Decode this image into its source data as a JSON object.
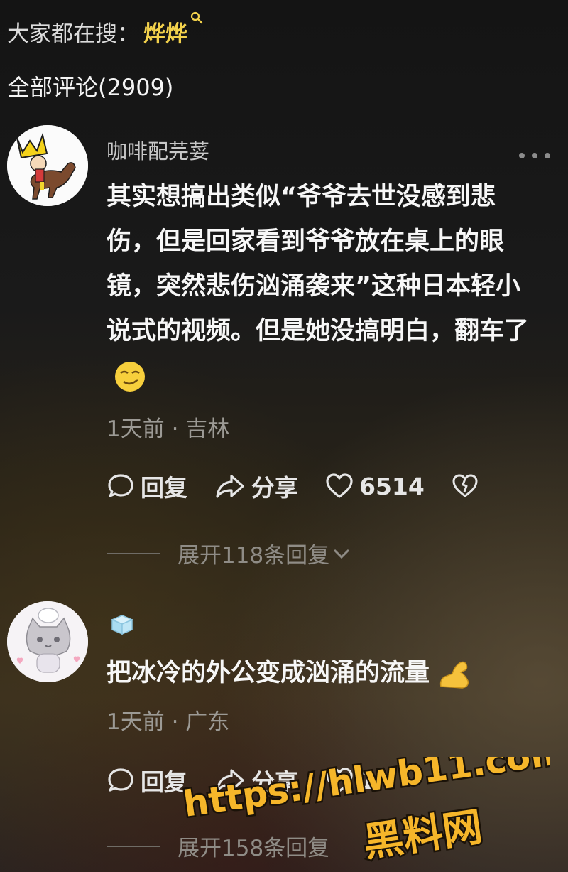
{
  "header": {
    "search_prefix": "大家都在搜：",
    "search_keyword": "烨烨",
    "comment_count_label": "全部评论(2909)"
  },
  "comments": [
    {
      "username": "咖啡配芫荽",
      "text": "其实想搞出类似“爷爷去世没感到悲伤，但是回家看到爷爷放在桌上的眼镜，突然悲伤汹涌袭来”这种日本轻小说式的视频。但是她没搞明白，翻车了",
      "time_location": "1天前 · 吉林",
      "reply_label": "回复",
      "share_label": "分享",
      "like_count": "6514",
      "expand_label": "展开118条回复"
    },
    {
      "username": "",
      "text": "把冰冷的外公变成汹涌的流量",
      "time_location": "1天前 · 广东",
      "reply_label": "回复",
      "share_label": "分享",
      "like_count": "1",
      "expand_label": "展开158条回复"
    }
  ],
  "watermark": {
    "url": "https://hlwb11.com",
    "name": "黑料网"
  },
  "colors": {
    "keyword": "#f3d24c",
    "watermark_fill": "#f6b62a",
    "watermark_stroke": "#1a1208"
  }
}
